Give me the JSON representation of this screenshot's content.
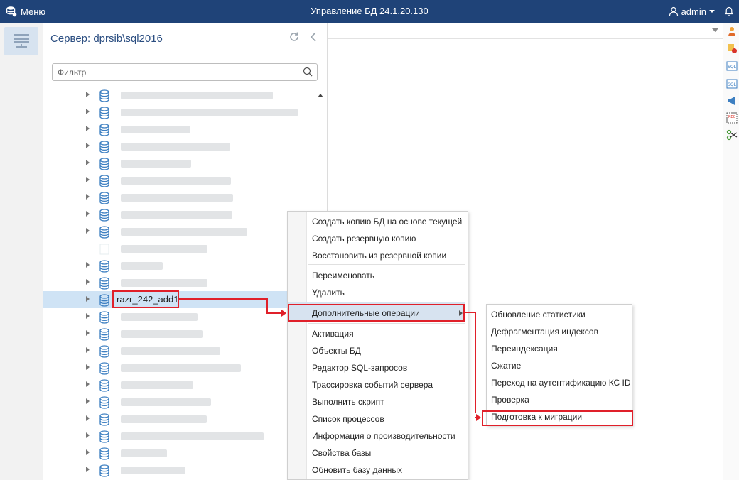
{
  "topbar": {
    "menu_label": "Меню",
    "title": "Управление БД 24.1.20.130",
    "user_name": "admin"
  },
  "panel": {
    "title": "Сервер: dprsib\\sql2016",
    "filter_placeholder": "Фильтр"
  },
  "tree": {
    "selected_db_name": "razr_242_add1"
  },
  "context_menu": {
    "items": [
      "Создать копию БД на основе текущей",
      "Создать резервную копию",
      "Восстановить из резервной копии",
      "Переименовать",
      "Удалить",
      "Дополнительные операции",
      "Активация",
      "Объекты БД",
      "Редактор SQL-запросов",
      "Трассировка событий сервера",
      "Выполнить скрипт",
      "Список процессов",
      "Информация о производительности",
      "Свойства базы",
      "Обновить базу данных"
    ]
  },
  "submenu": {
    "items": [
      "Обновление статистики",
      "Дефрагментация индексов",
      "Переиндексация",
      "Сжатие",
      "Переход на аутентификацию КС ID",
      "Проверка",
      "Подготовка к миграции"
    ]
  },
  "colors": {
    "topbar": "#1f4378",
    "accent": "#2a4d80",
    "selection": "#cfe3f5",
    "annotation": "#e0202a",
    "db_icon": "#3d7fc1"
  }
}
